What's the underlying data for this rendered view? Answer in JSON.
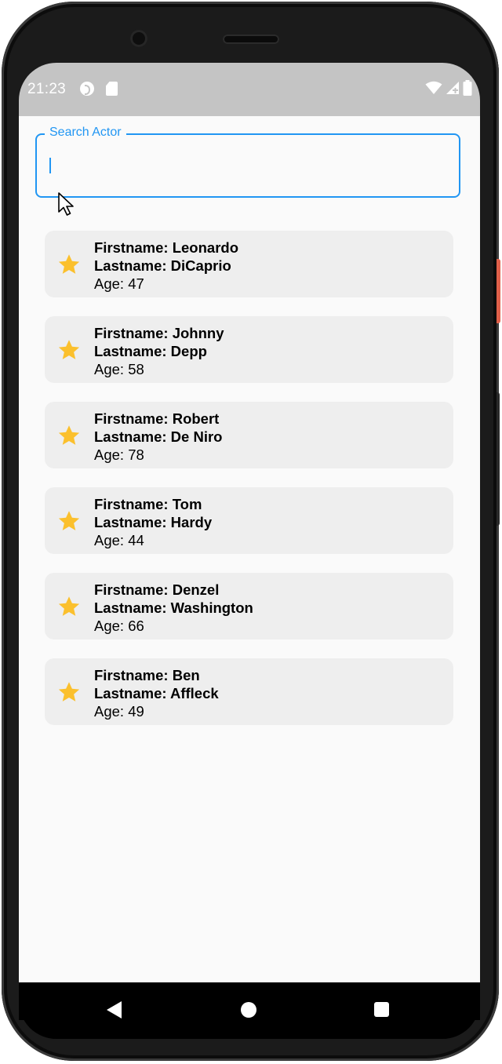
{
  "status_bar": {
    "time": "21:23",
    "icons": [
      "data-saver-icon",
      "sd-card-icon",
      "wifi-icon",
      "signal-icon",
      "battery-icon"
    ]
  },
  "search": {
    "label": "Search Actor",
    "value": ""
  },
  "actors": [
    {
      "firstname": "Firstname: Leonardo",
      "lastname": "Lastname: DiCaprio",
      "age": "Age: 47"
    },
    {
      "firstname": "Firstname: Johnny",
      "lastname": "Lastname: Depp",
      "age": "Age: 58"
    },
    {
      "firstname": "Firstname: Robert",
      "lastname": "Lastname: De Niro",
      "age": "Age: 78"
    },
    {
      "firstname": "Firstname: Tom",
      "lastname": "Lastname: Hardy",
      "age": "Age: 44"
    },
    {
      "firstname": "Firstname: Denzel",
      "lastname": "Lastname: Washington",
      "age": "Age: 66"
    },
    {
      "firstname": "Firstname: Ben",
      "lastname": "Lastname: Affleck",
      "age": "Age: 49"
    }
  ],
  "colors": {
    "accent": "#2196f3",
    "star": "#fbc02d",
    "card_background": "#eeeeee",
    "status_bar": "#c4c4c4"
  },
  "nav": {
    "icons": [
      "back-icon",
      "home-icon",
      "recents-icon"
    ]
  }
}
